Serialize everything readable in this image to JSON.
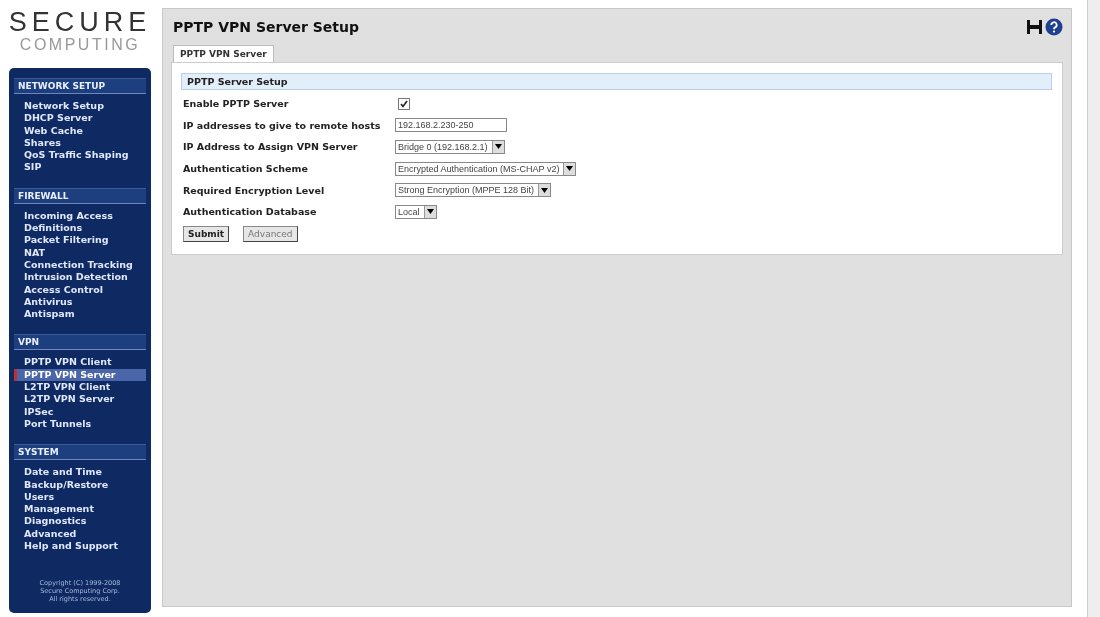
{
  "logo": {
    "line_1": "SECURE",
    "line_2": "COMPUTING"
  },
  "sidebar": {
    "sections": [
      {
        "title": "NETWORK SETUP",
        "items": [
          {
            "label": "Network Setup",
            "selected": false
          },
          {
            "label": "DHCP Server",
            "selected": false
          },
          {
            "label": "Web Cache",
            "selected": false
          },
          {
            "label": "Shares",
            "selected": false
          },
          {
            "label": "QoS Traffic Shaping",
            "selected": false
          },
          {
            "label": "SIP",
            "selected": false
          }
        ]
      },
      {
        "title": "FIREWALL",
        "items": [
          {
            "label": "Incoming Access",
            "selected": false
          },
          {
            "label": "Definitions",
            "selected": false
          },
          {
            "label": "Packet Filtering",
            "selected": false
          },
          {
            "label": "NAT",
            "selected": false
          },
          {
            "label": "Connection Tracking",
            "selected": false
          },
          {
            "label": "Intrusion Detection",
            "selected": false
          },
          {
            "label": "Access Control",
            "selected": false
          },
          {
            "label": "Antivirus",
            "selected": false
          },
          {
            "label": "Antispam",
            "selected": false
          }
        ]
      },
      {
        "title": "VPN",
        "items": [
          {
            "label": "PPTP VPN Client",
            "selected": false
          },
          {
            "label": "PPTP VPN Server",
            "selected": true
          },
          {
            "label": "L2TP VPN Client",
            "selected": false
          },
          {
            "label": "L2TP VPN Server",
            "selected": false
          },
          {
            "label": "IPSec",
            "selected": false
          },
          {
            "label": "Port Tunnels",
            "selected": false
          }
        ]
      },
      {
        "title": "SYSTEM",
        "items": [
          {
            "label": "Date and Time",
            "selected": false
          },
          {
            "label": "Backup/Restore",
            "selected": false
          },
          {
            "label": "Users",
            "selected": false
          },
          {
            "label": "Management",
            "selected": false
          },
          {
            "label": "Diagnostics",
            "selected": false
          },
          {
            "label": "Advanced",
            "selected": false
          },
          {
            "label": "Help and Support",
            "selected": false
          }
        ]
      }
    ],
    "copyright": [
      "Copyright (C) 1999-2008",
      "Secure Computing Corp.",
      "All rights reserved."
    ]
  },
  "page": {
    "title": "PPTP VPN Server Setup",
    "tabs": [
      {
        "label": "PPTP VPN Server",
        "selected": true
      }
    ],
    "section_title": "PPTP Server Setup",
    "fields": [
      {
        "kind": "checkbox",
        "label": "Enable PPTP Server",
        "checked": true
      },
      {
        "kind": "text",
        "label": "IP addresses to give to remote hosts",
        "value": "192.168.2.230-250"
      },
      {
        "kind": "select",
        "label": "IP Address to Assign VPN Server",
        "value": "Bridge 0 (192.168.2.1)"
      },
      {
        "kind": "select",
        "label": "Authentication Scheme",
        "value": "Encrypted Authentication (MS-CHAP v2)"
      },
      {
        "kind": "select",
        "label": "Required Encryption Level",
        "value": "Strong Encryption (MPPE 128 Bit)"
      },
      {
        "kind": "select",
        "label": "Authentication Database",
        "value": "Local"
      }
    ],
    "buttons": [
      {
        "label": "Submit",
        "disabled": false
      },
      {
        "label": "Advanced",
        "disabled": true
      }
    ]
  }
}
